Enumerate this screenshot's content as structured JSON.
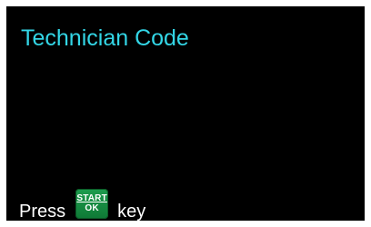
{
  "screen": {
    "title": "Technician Code",
    "title_color": "#33d6e6",
    "background_color": "#000000"
  },
  "prompt": {
    "before": "Press",
    "after": "key",
    "key": {
      "icon": "start-ok-key-icon",
      "line1": "START",
      "line2": "OK",
      "color": "#1a9149"
    }
  }
}
